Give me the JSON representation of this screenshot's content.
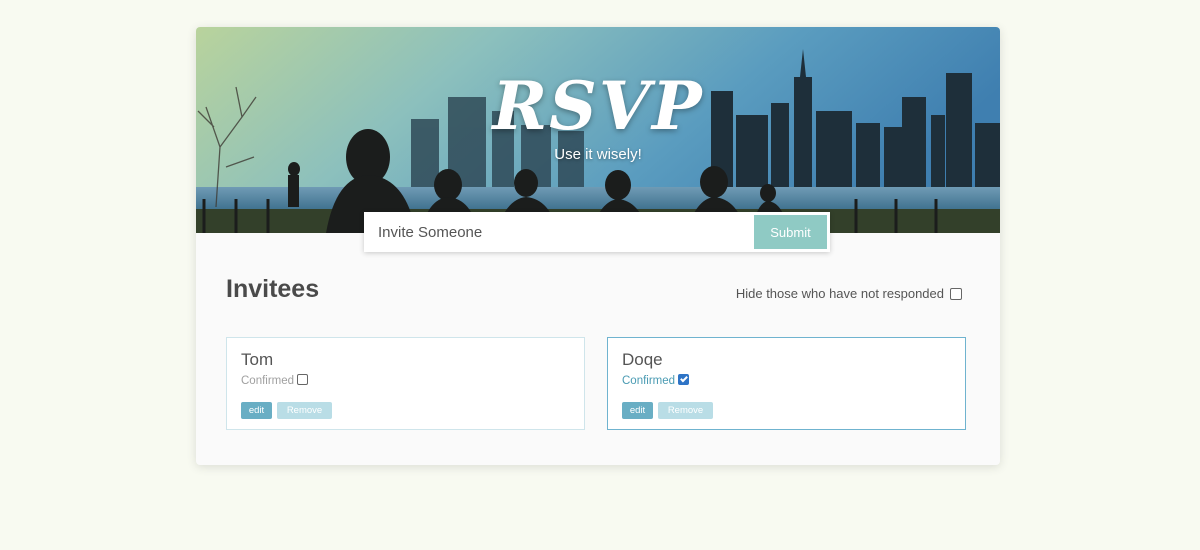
{
  "header": {
    "title": "RSVP",
    "subtitle": "Use it wisely!"
  },
  "invite": {
    "placeholder": "Invite Someone",
    "submit_label": "Submit"
  },
  "invitees": {
    "title": "Invitees",
    "filter_label": "Hide those who have not responded",
    "filter_checked": false
  },
  "guests": [
    {
      "name": "Tom",
      "status_label": "Confirmed",
      "confirmed": false,
      "edit_label": "edit",
      "remove_label": "Remove"
    },
    {
      "name": "Doqe",
      "status_label": "Confirmed",
      "confirmed": true,
      "edit_label": "edit",
      "remove_label": "Remove"
    }
  ],
  "colors": {
    "page_bg": "#f8faf1",
    "accent": "#8fcac4",
    "edit_button": "#69aec4",
    "remove_button": "#b9dde6",
    "confirmed_text": "#4a9bb3",
    "checkbox_checked": "#2e74c6"
  }
}
